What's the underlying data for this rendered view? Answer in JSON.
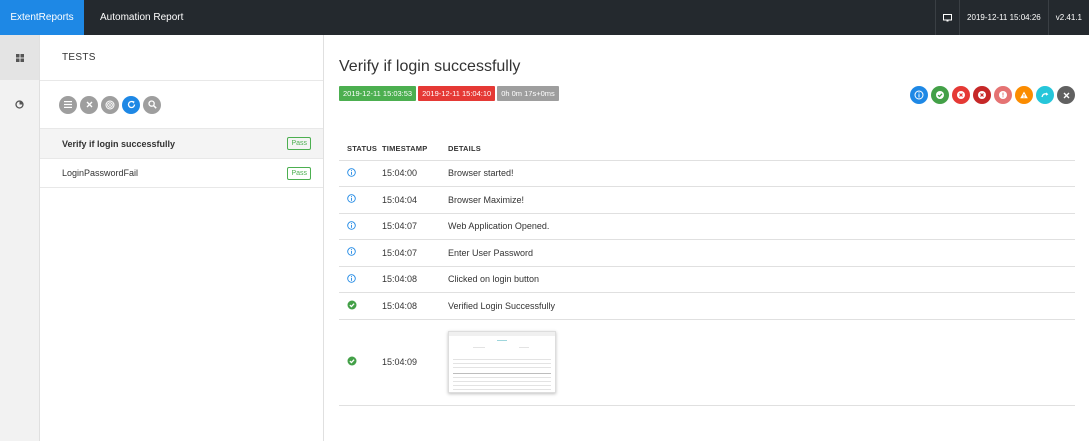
{
  "header": {
    "brand": "ExtentReports",
    "report_name": "Automation Report",
    "timestamp": "2019-12-11 15:04:26",
    "version": "v2.41.1",
    "monitor_icon": "monitor-icon"
  },
  "rail": {
    "items": [
      {
        "icon": "dashboard-grid-icon"
      },
      {
        "icon": "analytics-icon"
      }
    ]
  },
  "tests_panel": {
    "title": "TESTS",
    "filters": [
      "list-icon",
      "close-icon",
      "target-icon",
      "refresh-icon",
      "search-icon"
    ],
    "items": [
      {
        "name": "Verify if login successfully",
        "status": "Pass"
      },
      {
        "name": "LoginPasswordFail",
        "status": "Pass"
      }
    ]
  },
  "detail": {
    "title": "Verify if login successfully",
    "start_time": "2019-12-11 15:03:53",
    "end_time": "2019-12-11 15:04:10",
    "duration": "0h 0m 17s+0ms",
    "status_filters": [
      {
        "icon": "info-icon",
        "color": "#1e88e5"
      },
      {
        "icon": "check-icon",
        "color": "#43a047"
      },
      {
        "icon": "fail-icon",
        "color": "#e53935"
      },
      {
        "icon": "fatal-icon",
        "color": "#c62828"
      },
      {
        "icon": "error-icon",
        "color": "#e57373"
      },
      {
        "icon": "warning-icon",
        "color": "#fb8c00"
      },
      {
        "icon": "skip-icon",
        "color": "#26c6da"
      },
      {
        "icon": "clear-icon",
        "color": "#616161"
      }
    ],
    "columns": {
      "status": "STATUS",
      "timestamp": "TIMESTAMP",
      "details": "DETAILS"
    },
    "logs": [
      {
        "status": "info",
        "time": "15:04:00",
        "details": "Browser started!"
      },
      {
        "status": "info",
        "time": "15:04:04",
        "details": "Browser Maximize!"
      },
      {
        "status": "info",
        "time": "15:04:07",
        "details": "Web Application Opened."
      },
      {
        "status": "info",
        "time": "15:04:07",
        "details": "Enter User Password"
      },
      {
        "status": "info",
        "time": "15:04:08",
        "details": "Clicked on login button"
      },
      {
        "status": "pass",
        "time": "15:04:08",
        "details": "Verified Login Successfully"
      },
      {
        "status": "pass",
        "time": "15:04:09",
        "details": ""
      }
    ]
  }
}
